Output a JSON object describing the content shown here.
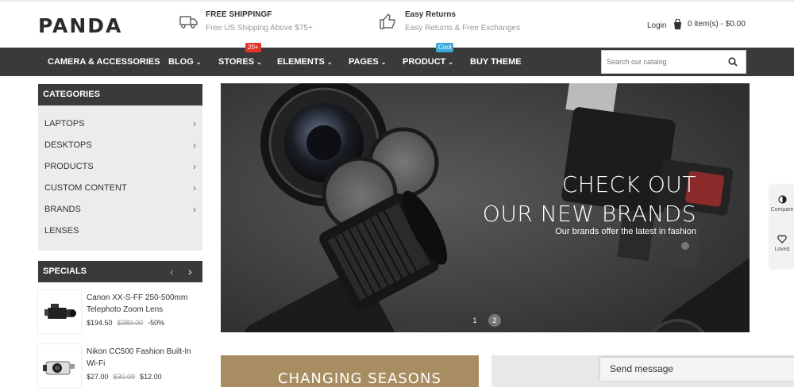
{
  "header": {
    "logo": "PANDA",
    "promo1": {
      "title": "FREE SHIPPINGF",
      "subtitle": "Free US Shipping Above $75+",
      "icon": "truck-icon"
    },
    "promo2": {
      "title": "Easy Returns",
      "subtitle": "Easy Returns & Free Exchanges",
      "icon": "thumbs-up-icon"
    },
    "login": "Login",
    "cart": "0 item(s) - $0.00"
  },
  "nav": {
    "items": [
      {
        "label": "CAMERA & ACCESSORIES"
      },
      {
        "label": "BLOG",
        "chevron": "⌄"
      },
      {
        "label": "STORES",
        "chevron": "⌄",
        "badge": "20+"
      },
      {
        "label": "ELEMENTS",
        "chevron": "⌄"
      },
      {
        "label": "PAGES",
        "chevron": "⌄"
      },
      {
        "label": "PRODUCT",
        "chevron": "⌄",
        "badge": "Cool"
      },
      {
        "label": "BUY THEME"
      }
    ],
    "badge_colors": {
      "stores": "#e2352a",
      "product": "#3fa9dc"
    },
    "search_placeholder": "Search our catalog"
  },
  "categories": {
    "title": "CATEGORIES",
    "items": [
      {
        "label": "LAPTOPS",
        "arrow": "›"
      },
      {
        "label": "DESKTOPS",
        "arrow": "›"
      },
      {
        "label": "PRODUCTS",
        "arrow": "›"
      },
      {
        "label": "CUSTOM CONTENT",
        "arrow": "›"
      },
      {
        "label": "BRANDS",
        "arrow": "›"
      },
      {
        "label": "LENSES"
      }
    ]
  },
  "specials": {
    "title": "SPECIALS",
    "prev": "‹",
    "next": "›",
    "products": [
      {
        "name": "Canon XX-S-FF 250-500mm Telephoto Zoom Lens",
        "price": "$194.50",
        "old_price": "$389.00",
        "discount": "-50%"
      },
      {
        "name": "Nikon CC500 Fashion Built-In Wi-Fi",
        "price": "$27.00",
        "old_price": "$30.00",
        "discount": "$12.00"
      }
    ]
  },
  "banner": {
    "line1": "CHECK OUT",
    "line2": "OUR NEW BRANDS",
    "subtitle": "Our brands offer the latest in fashion",
    "dots": [
      "1",
      "2"
    ]
  },
  "promo_bottom": {
    "left_text": "CHANGING SEASONS"
  },
  "side_tools": {
    "compare": "Compare",
    "loved": "Loved"
  },
  "chat": {
    "label": "Send message"
  },
  "colors": {
    "nav_bg": "#3a3a3a",
    "accent_gold": "#a78d61"
  }
}
